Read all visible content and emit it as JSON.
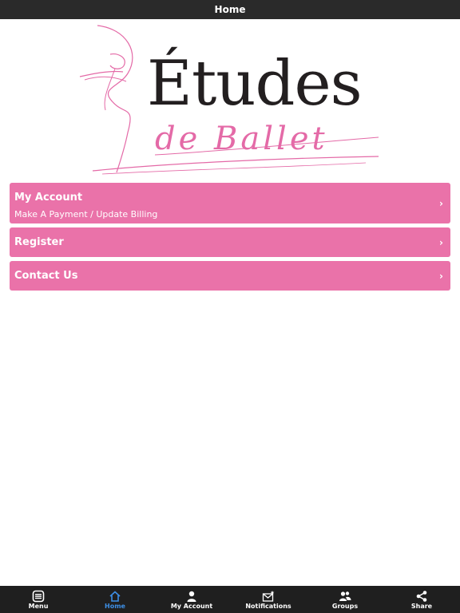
{
  "header": {
    "title": "Home"
  },
  "logo": {
    "main_text": "Études",
    "script_text": "de Ballet"
  },
  "menu": {
    "items": [
      {
        "title": "My Account",
        "subtitle": "Make A Payment / Update Billing",
        "chevron": "›"
      },
      {
        "title": "Register",
        "chevron": "›"
      },
      {
        "title": "Contact Us",
        "chevron": "›"
      }
    ]
  },
  "bottom_nav": {
    "items": [
      {
        "label": "Menu",
        "icon": "menu-icon"
      },
      {
        "label": "Home",
        "icon": "home-icon",
        "active": true
      },
      {
        "label": "My Account",
        "icon": "person-icon"
      },
      {
        "label": "Notifications",
        "icon": "envelope-star-icon"
      },
      {
        "label": "Groups",
        "icon": "groups-icon"
      },
      {
        "label": "Share",
        "icon": "share-icon"
      }
    ]
  },
  "colors": {
    "topbar": "#2a2a2a",
    "row_pink": "#ea72a9",
    "nav_bg": "#1f1f1f",
    "nav_active": "#3d8fe6",
    "logo_pink": "#e46aa7"
  }
}
